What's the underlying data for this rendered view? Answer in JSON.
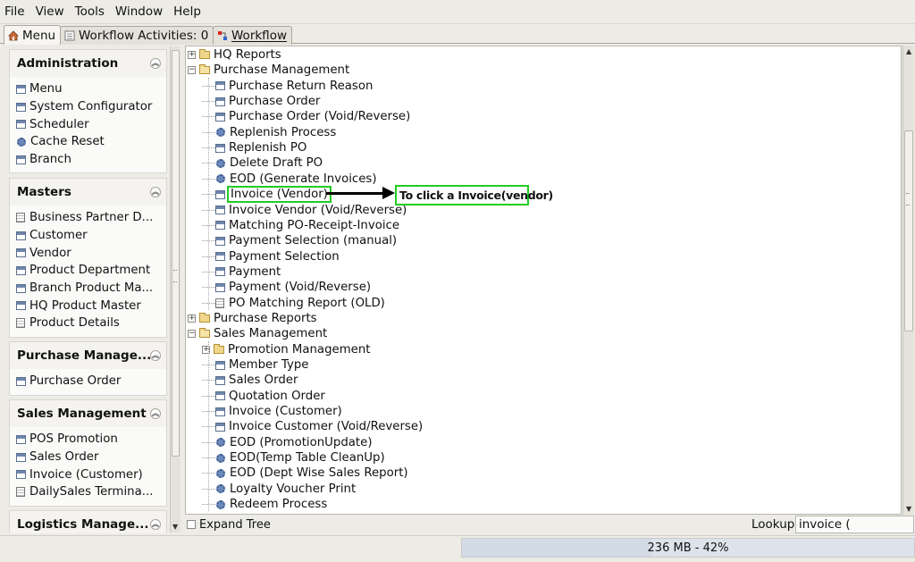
{
  "menubar": {
    "items": [
      "File",
      "View",
      "Tools",
      "Window",
      "Help"
    ]
  },
  "tabs": [
    {
      "label": "Menu",
      "icon": "home-icon"
    },
    {
      "label": "Workflow Activities: 0",
      "icon": "list-icon"
    },
    {
      "label": "Workflow",
      "icon": "workflow-icon"
    }
  ],
  "sidebar": {
    "sections": [
      {
        "title": "Administration",
        "items": [
          {
            "label": "Menu",
            "icon": "window-icon"
          },
          {
            "label": "System Configurator",
            "icon": "window-icon"
          },
          {
            "label": "Scheduler",
            "icon": "window-icon"
          },
          {
            "label": "Cache Reset",
            "icon": "gear-icon"
          },
          {
            "label": "Branch",
            "icon": "window-icon"
          }
        ]
      },
      {
        "title": "Masters",
        "items": [
          {
            "label": "Business Partner D...",
            "icon": "document-icon"
          },
          {
            "label": "Customer",
            "icon": "window-icon"
          },
          {
            "label": "Vendor",
            "icon": "window-icon"
          },
          {
            "label": "Product Department",
            "icon": "window-icon"
          },
          {
            "label": "Branch Product Ma...",
            "icon": "window-icon"
          },
          {
            "label": "HQ Product Master",
            "icon": "window-icon"
          },
          {
            "label": "Product Details",
            "icon": "document-icon"
          }
        ]
      },
      {
        "title": "Purchase Manage...",
        "items": [
          {
            "label": "Purchase Order",
            "icon": "window-icon"
          }
        ]
      },
      {
        "title": "Sales Management",
        "items": [
          {
            "label": "POS Promotion",
            "icon": "window-icon"
          },
          {
            "label": "Sales Order",
            "icon": "window-icon"
          },
          {
            "label": "Invoice (Customer)",
            "icon": "window-icon"
          },
          {
            "label": "DailySales Termina...",
            "icon": "document-icon"
          }
        ]
      },
      {
        "title": "Logistics Manage...",
        "items": []
      }
    ]
  },
  "tree": {
    "rows": [
      {
        "label": "HQ Reports",
        "type": "folder",
        "level": 0,
        "expander": "+"
      },
      {
        "label": "Purchase Management",
        "type": "folder-open",
        "level": 0,
        "expander": "-"
      },
      {
        "label": "Purchase Return Reason",
        "type": "window",
        "level": 1
      },
      {
        "label": "Purchase Order",
        "type": "window",
        "level": 1
      },
      {
        "label": "Purchase Order (Void/Reverse)",
        "type": "window",
        "level": 1
      },
      {
        "label": "Replenish Process",
        "type": "gear",
        "level": 1
      },
      {
        "label": "Replenish PO",
        "type": "window",
        "level": 1
      },
      {
        "label": "Delete Draft PO",
        "type": "gear",
        "level": 1
      },
      {
        "label": "EOD (Generate Invoices)",
        "type": "gear",
        "level": 1
      },
      {
        "label": "Invoice (Vendor)",
        "type": "window",
        "level": 1,
        "highlighted": true
      },
      {
        "label": "Invoice Vendor (Void/Reverse)",
        "type": "window",
        "level": 1
      },
      {
        "label": "Matching PO-Receipt-Invoice",
        "type": "window",
        "level": 1
      },
      {
        "label": "Payment Selection (manual)",
        "type": "window",
        "level": 1
      },
      {
        "label": "Payment Selection",
        "type": "window",
        "level": 1
      },
      {
        "label": "Payment",
        "type": "window",
        "level": 1
      },
      {
        "label": "Payment (Void/Reverse)",
        "type": "window",
        "level": 1
      },
      {
        "label": "PO Matching Report (OLD)",
        "type": "document",
        "level": 1
      },
      {
        "label": "Purchase Reports",
        "type": "folder",
        "level": 0,
        "expander": "+"
      },
      {
        "label": "Sales Management",
        "type": "folder-open",
        "level": 0,
        "expander": "-"
      },
      {
        "label": "Promotion Management",
        "type": "folder",
        "level": 1,
        "expander": "+"
      },
      {
        "label": "Member Type",
        "type": "window",
        "level": 1
      },
      {
        "label": "Sales Order",
        "type": "window",
        "level": 1
      },
      {
        "label": "Quotation Order",
        "type": "window",
        "level": 1
      },
      {
        "label": "Invoice (Customer)",
        "type": "window",
        "level": 1
      },
      {
        "label": "Invoice Customer (Void/Reverse)",
        "type": "window",
        "level": 1
      },
      {
        "label": "EOD (PromotionUpdate)",
        "type": "gear",
        "level": 1
      },
      {
        "label": "EOD(Temp Table CleanUp)",
        "type": "gear",
        "level": 1
      },
      {
        "label": "EOD (Dept Wise Sales Report)",
        "type": "gear",
        "level": 1
      },
      {
        "label": "Loyalty Voucher Print",
        "type": "gear",
        "level": 1
      },
      {
        "label": "Redeem Process",
        "type": "gear",
        "level": 1
      }
    ]
  },
  "annotation": {
    "callout_text": "To click a Invoice(vendor)",
    "highlight_color": "#22cc22"
  },
  "bottom": {
    "expand_tree_label": "Expand Tree",
    "lookup_label": "Lookup",
    "lookup_value": "invoice ("
  },
  "status": {
    "memory_text": "236 MB - 42%",
    "memory_percent": 42
  }
}
